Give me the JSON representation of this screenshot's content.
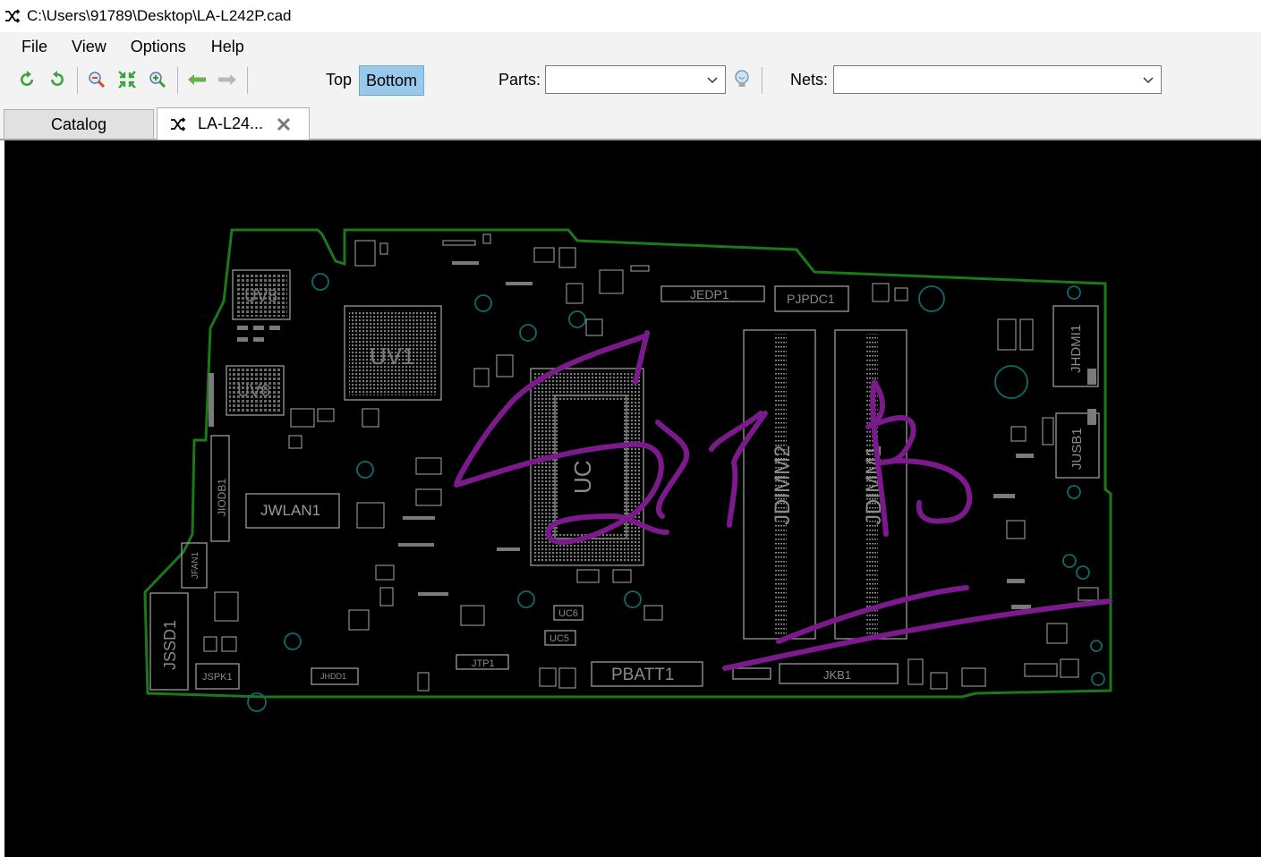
{
  "window": {
    "title": "C:\\Users\\91789\\Desktop\\LA-L242P.cad",
    "app_icon": "shuffle-icon"
  },
  "menu": [
    "File",
    "View",
    "Options",
    "Help"
  ],
  "toolbar": {
    "icons": [
      "refresh-icon",
      "rotate-icon",
      "zoom-in-icon",
      "fit-icon",
      "zoom-out-icon",
      "back-arrow-icon",
      "forward-arrow-icon"
    ],
    "layer_top": "Top",
    "layer_bottom": "Bottom",
    "active_layer": "Bottom",
    "parts_label": "Parts:",
    "parts_value": "",
    "hint_icon": "lightbulb-icon",
    "nets_label": "Nets:",
    "nets_value": ""
  },
  "tabs": [
    {
      "label": "Catalog",
      "active": false
    },
    {
      "label": "LA-L24...",
      "active": true,
      "icon": "shuffle-icon",
      "close_icon": "close-icon"
    }
  ],
  "board": {
    "outline_color": "#1a7a1a",
    "annotation_color": "#7b1a8a",
    "components": {
      "uv8": "UV8",
      "uv6": "UV6",
      "uv1": "UV1",
      "uc": "UC",
      "jedp1": "JEDP1",
      "pjpdc1": "PJPDC1",
      "jhdmi1": "JHDMI1",
      "jusb1": "JUSB1",
      "jdimm2": "JDIMM2",
      "jdimm1": "JDIMM1",
      "jwlan1": "JWLAN1",
      "jiodb1": "JIODB1",
      "jfan1": "JFAN1",
      "jssd1": "JSSD1",
      "jspk1": "JSPK1",
      "jhdd1": "JHDD1",
      "jtp1": "JTP1",
      "uc6": "UC6",
      "uc5": "UC5",
      "pbatt1": "PBATT1",
      "jkb1": "JKB1"
    }
  }
}
